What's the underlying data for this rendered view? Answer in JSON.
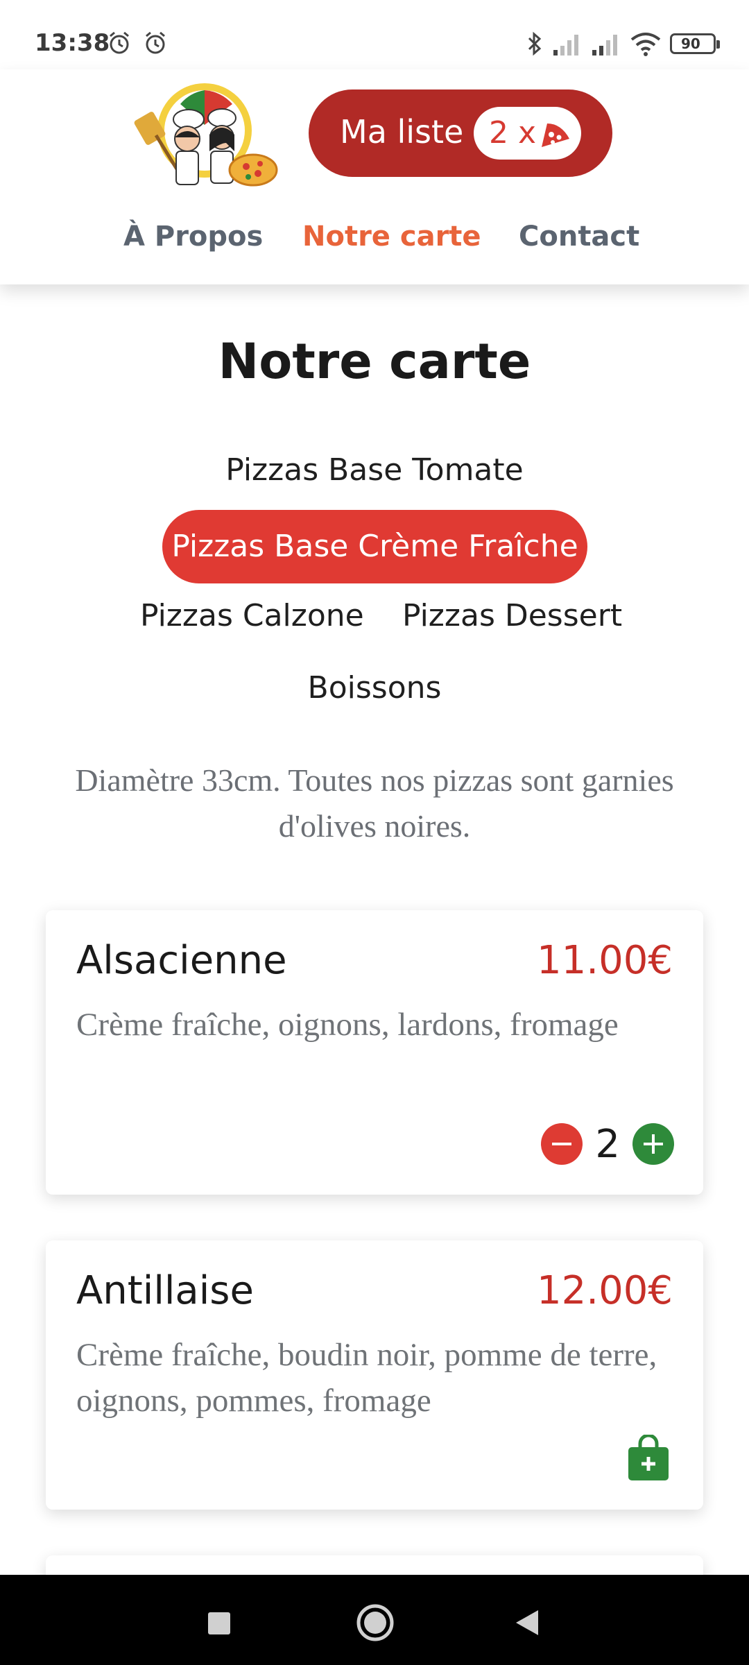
{
  "status_bar": {
    "time": "13:38",
    "battery": "90",
    "icons": [
      "alarm-icon",
      "alarm-icon",
      "bluetooth-icon",
      "signal-icon",
      "signal-icon",
      "wifi-icon",
      "battery-icon"
    ]
  },
  "header": {
    "logo": "pizza-chefs-logo",
    "cart_button": {
      "label": "Ma liste",
      "count": "2 x",
      "icon": "pizza-slice-icon"
    },
    "nav": [
      {
        "label": "À Propos"
      },
      {
        "label": "Notre carte",
        "active": true
      },
      {
        "label": "Contact"
      }
    ]
  },
  "colors": {
    "primary": "#e03a33",
    "dark_red": "#b12a26",
    "nav_active": "#e8643a",
    "price": "#c62f28",
    "add_green": "#2e8a3a"
  },
  "page": {
    "title": "Notre carte",
    "categories": [
      {
        "label": "Pizzas Base Tomate"
      },
      {
        "label": "Pizzas Base Crème Fraîche",
        "active": true
      },
      {
        "label": "Pizzas Calzone"
      },
      {
        "label": "Pizzas Dessert"
      },
      {
        "label": "Boissons"
      }
    ],
    "intro": "Diamètre 33cm. Toutes nos pizzas sont garnies d'olives noires."
  },
  "items": [
    {
      "name": "Alsacienne",
      "price": "11.00€",
      "description": "Crème fraîche, oignons, lardons, fromage",
      "quantity": "2"
    },
    {
      "name": "Antillaise",
      "price": "12.00€",
      "description": "Crème fraîche, boudin noir, pomme de terre, oignons, pommes, fromage"
    }
  ],
  "system_nav": [
    "recents-icon",
    "home-icon",
    "back-icon"
  ]
}
